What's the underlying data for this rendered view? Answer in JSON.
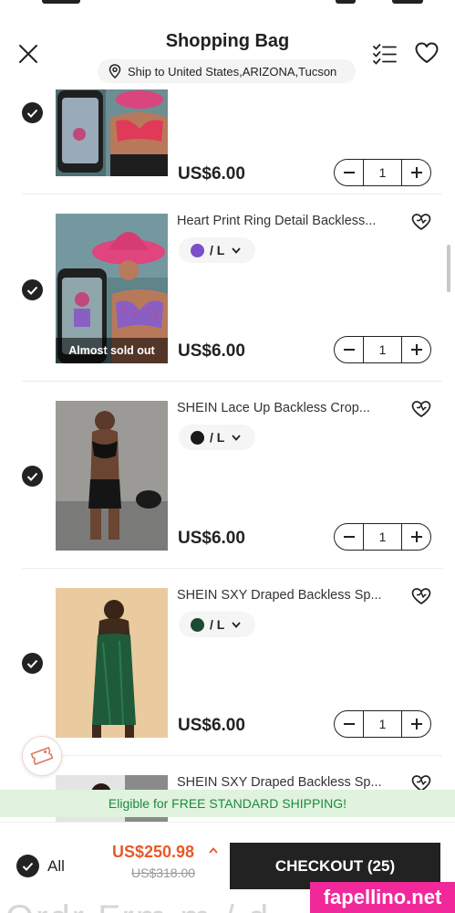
{
  "header": {
    "title": "Shopping Bag",
    "shipping_location": "Ship to United States,ARIZONA,Tucson"
  },
  "items": [
    {
      "name": "",
      "price": "US$6.00",
      "quantity": "1",
      "color_swatch": "#c62858",
      "checked": true
    },
    {
      "name": "Heart Print Ring Detail Backless...",
      "variant": "/ L",
      "color_swatch": "#7b4fc8",
      "badge": "Almost sold out",
      "price": "US$6.00",
      "quantity": "1",
      "checked": true
    },
    {
      "name": "SHEIN Lace Up Backless Crop...",
      "variant": "/ L",
      "color_swatch": "#1a1a1a",
      "price": "US$6.00",
      "quantity": "1",
      "checked": true
    },
    {
      "name": "SHEIN SXY Draped Backless Sp...",
      "variant": "/ L",
      "color_swatch": "#1d4a30",
      "price": "US$6.00",
      "quantity": "1",
      "checked": true
    },
    {
      "name": "SHEIN SXY Draped Backless Sp..."
    }
  ],
  "banner": {
    "free_shipping": "Eligible for FREE STANDARD SHIPPING!"
  },
  "footer": {
    "select_all_label": "All",
    "total": "US$250.98",
    "original_total": "US$318.00",
    "checkout_label": "CHECKOUT (25)"
  },
  "watermark": "fapellino.net",
  "colors": {
    "accent_price": "#e65a2a",
    "free_shipping_text": "#1f8a3c",
    "free_shipping_bg": "#dff3df",
    "primary": "#222222"
  },
  "icons": [
    "close-icon",
    "location-pin-icon",
    "checklist-icon",
    "heart-icon",
    "check-icon",
    "heart-plus-icon",
    "chevron-down-icon",
    "minus-icon",
    "plus-icon",
    "coupon-icon",
    "chevron-up-icon"
  ]
}
